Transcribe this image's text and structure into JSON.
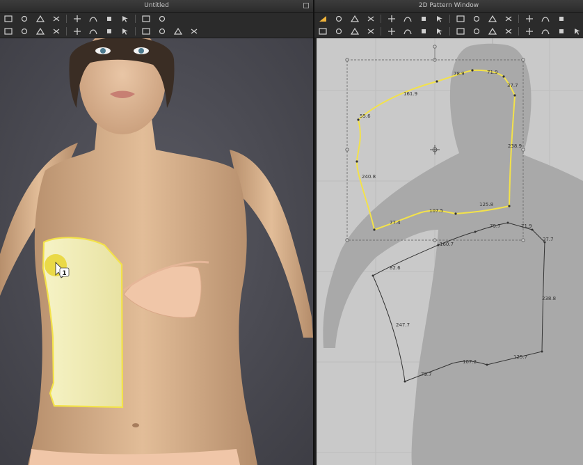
{
  "window3d": {
    "title": "Untitled",
    "toolbar_row1": [
      "cloth-icon",
      "node-icon",
      "stamp-icon",
      "pin-icon",
      "shirt-icon",
      "tape-icon",
      "fold-icon",
      "select-arrow-icon",
      "lasso-icon",
      "ruler-icon"
    ],
    "toolbar_row2": [
      "move-icon",
      "point-icon",
      "sphere-icon",
      "line-icon",
      "grab-icon",
      "avatar-icon",
      "measure-icon",
      "pin-line-icon",
      "fit-icon",
      "arrow-pin-icon",
      "tshirt-icon",
      "reset-icon"
    ],
    "cursor_badge": "1"
  },
  "window2d": {
    "title": "2D Pattern Window",
    "toolbar_row1": [
      "transform-icon",
      "edit-point-icon",
      "edit-curve-icon",
      "add-point-icon",
      "curve-point-icon",
      "draw-curve-icon",
      "polygon-icon",
      "rectangle-icon",
      "circle-icon",
      "internal-rect-icon",
      "internal-square-icon",
      "internal-circle-icon",
      "dart-icon",
      "fold-icon",
      "segment-icon"
    ],
    "toolbar_row2": [
      "seam-icon",
      "segment-seam-icon",
      "free-seam-icon",
      "check-seam-icon",
      "tack-icon",
      "sew-icon",
      "pin-2d-icon",
      "fabric-icon",
      "texture-icon",
      "grain-icon",
      "edit-line-icon",
      "measure-line-icon",
      "dashed-line-icon",
      "zigzag-icon",
      "knife-icon",
      "scissors-icon"
    ],
    "selected_pattern_dims": [
      "78.9",
      "71.9",
      "37.7",
      "161.9",
      "55.6",
      "238.9",
      "240.8",
      "107.5",
      "125.8",
      "77.4"
    ],
    "pattern_dims": [
      "79.7",
      "71.9",
      "37.7",
      "160.7",
      "82.6",
      "238.8",
      "247.7",
      "107.2",
      "125.7",
      "79.7"
    ]
  },
  "colors": {
    "selection": "#f3e24a",
    "cloth": "#f3f0b8",
    "workspace_3d": "#4b4b52",
    "workspace_2d": "#c9c9c9",
    "avatar_shadow": "#a9a9a9"
  }
}
